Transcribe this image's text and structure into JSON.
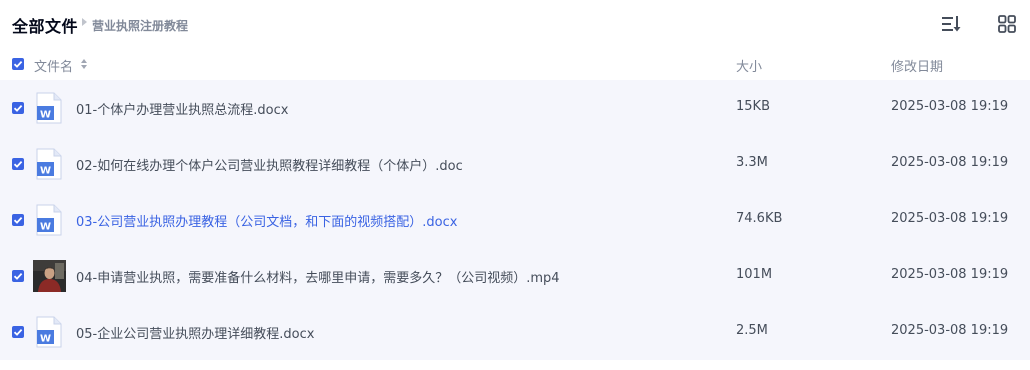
{
  "breadcrumb": {
    "root": "全部文件",
    "current": "营业执照注册教程"
  },
  "toolbar": {
    "sort_icon": "sort-list-icon",
    "view_icon": "grid-view-icon"
  },
  "columns": {
    "name": "文件名",
    "size": "大小",
    "modified": "修改日期"
  },
  "files": [
    {
      "name": "01-个体户办理营业执照总流程.docx",
      "size": "15KB",
      "modified": "2025-03-08 19:19",
      "icon": "word-doc-icon"
    },
    {
      "name": "02-如何在线办理个体户公司营业执照教程详细教程（个体户）.doc",
      "size": "3.3M",
      "modified": "2025-03-08 19:19",
      "icon": "word-doc-icon"
    },
    {
      "name": "03-公司营业执照办理教程（公司文档，和下面的视频搭配）.docx",
      "size": "74.6KB",
      "modified": "2025-03-08 19:19",
      "icon": "word-doc-icon"
    },
    {
      "name": "04-申请营业执照，需要准备什么材料，去哪里申请，需要多久？（公司视频）.mp4",
      "size": "101M",
      "modified": "2025-03-08 19:19",
      "icon": "video-thumbnail"
    },
    {
      "name": "05-企业公司营业执照办理详细教程.docx",
      "size": "2.5M",
      "modified": "2025-03-08 19:19",
      "icon": "word-doc-icon"
    }
  ],
  "colors": {
    "accent": "#3a63e3",
    "row_bg": "#f5f6fc",
    "text": "#454d5a",
    "muted": "#818999"
  }
}
